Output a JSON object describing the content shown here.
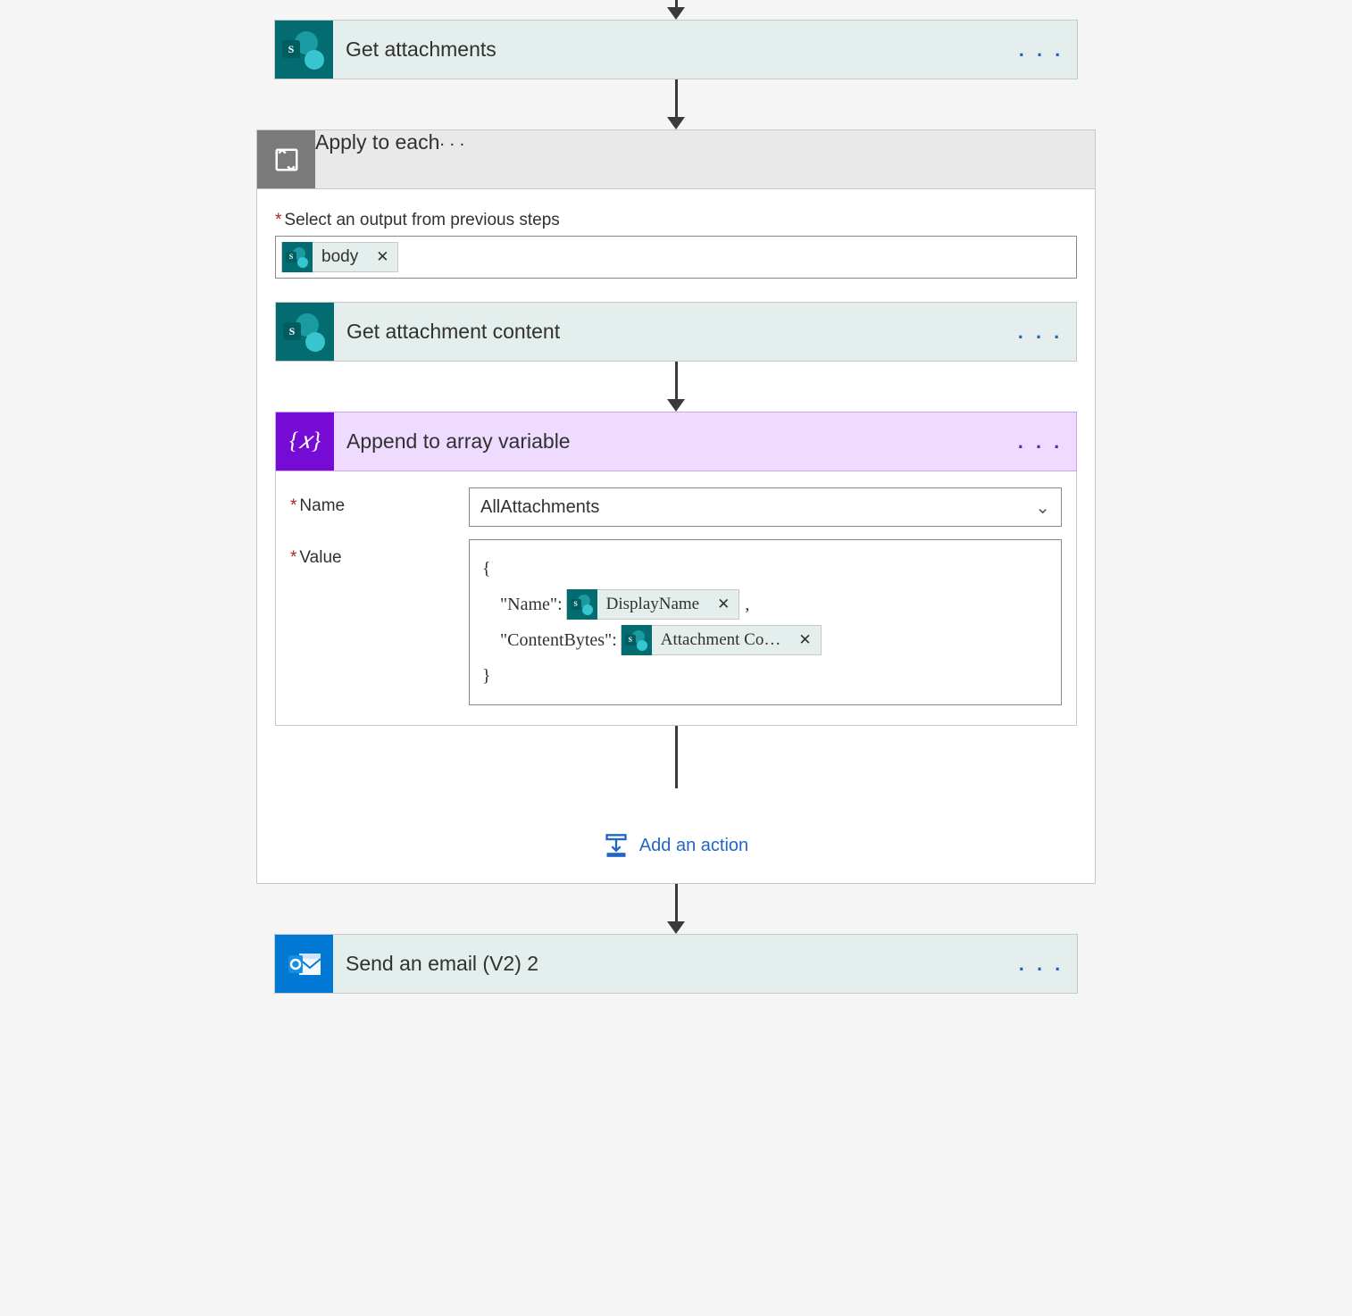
{
  "arrow_icon": "↓",
  "steps": {
    "get_attachments": {
      "title": "Get attachments"
    },
    "apply_each": {
      "title": "Apply to each",
      "select_label": "Select an output from previous steps",
      "body_token": "body"
    },
    "get_attachment_content": {
      "title": "Get attachment content"
    },
    "append": {
      "title": "Append to array variable",
      "name_label": "Name",
      "name_value": "AllAttachments",
      "value_label": "Value",
      "brace_open": "{",
      "brace_close": "}",
      "name_key": "\"Name\":",
      "displayname_token": "DisplayName",
      "contentbytes_key": "\"ContentBytes\":",
      "attachment_content_token": "Attachment Co…",
      "comma": ","
    },
    "add_action": "Add an action",
    "send_email": {
      "title": "Send an email (V2) 2"
    }
  },
  "glyphs": {
    "ellipsis": ". . .",
    "remove": "✕",
    "chevron_down": "⌄",
    "var_brace": "{𝑥}"
  }
}
